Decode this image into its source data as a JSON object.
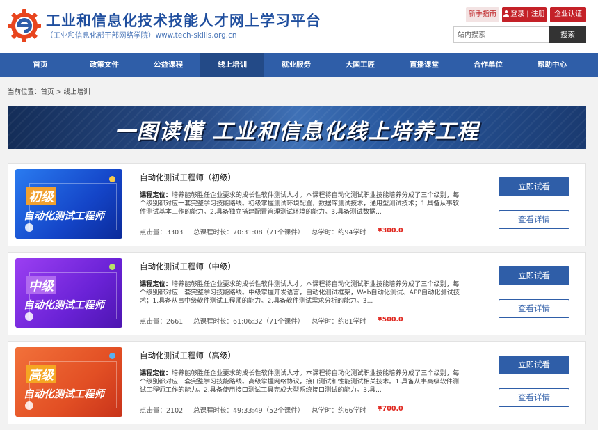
{
  "header": {
    "title": "工业和信息化技术技能人才网上学习平台",
    "subtitle": "（工业和信息化部干部网络学院）www.tech-skills.org.cn",
    "guide_label": "新手指南",
    "login_label": "登录 | 注册",
    "corp_label": "企业认证",
    "search_placeholder": "站内搜索",
    "search_button": "搜索"
  },
  "nav": {
    "items": [
      "首页",
      "政策文件",
      "公益课程",
      "线上培训",
      "就业服务",
      "大国工匠",
      "直播课堂",
      "合作单位",
      "帮助中心"
    ],
    "active": "线上培训"
  },
  "breadcrumb": "当前位置：首页 > 线上培训",
  "banner": {
    "text": "一图读懂 工业和信息化线上培养工程"
  },
  "courses": [
    {
      "thumb_level": "初级",
      "thumb_title": "自动化测试工程师",
      "title": "自动化测试工程师（初级）",
      "desc_label": "课程定位：",
      "desc": "培养能够胜任企业要求的成长性软件测试人才。本课程将自动化测试职业技能培养分成了三个级别，每个级别都对应一套完整学习技能路线。初级掌握测试环境配置，数据库测试技术，通用型测试技术；1.具备从事软件测试基本工作的能力。2.具备独立搭建配置管理测试环境的能力。3.具备测试数据...",
      "views": "点击量：3303",
      "duration": "总课程时长：70:31:08（71个课件）",
      "hours": "总学时：约94学时",
      "price": "¥300.0",
      "try_label": "立即试看",
      "detail_label": "查看详情"
    },
    {
      "thumb_level": "中级",
      "thumb_title": "自动化测试工程师",
      "title": "自动化测试工程师（中级）",
      "desc_label": "课程定位：",
      "desc": "培养能够胜任企业要求的成长性软件测试人才。本课程将自动化测试职业技能培养分成了三个级别，每个级别都对应一套完整学习技能路线。中级掌握开发语言，自动化测试框架，Web自动化测试、APP自动化测试技术；1.具备从事中级软件测试工程师的能力。2.具备软件测试需求分析的能力。3...",
      "views": "点击量：2661",
      "duration": "总课程时长：61:06:32（71个课件）",
      "hours": "总学时：约81学时",
      "price": "¥500.0",
      "try_label": "立即试看",
      "detail_label": "查看详情"
    },
    {
      "thumb_level": "高级",
      "thumb_title": "自动化测试工程师",
      "title": "自动化测试工程师（高级）",
      "desc_label": "课程定位：",
      "desc": "培养能够胜任企业要求的成长性软件测试人才。本课程将自动化测试职业技能培养分成了三个级别，每个级别都对应一套完整学习技能路线。高级掌握网络协议，接口测试和性能测试相关技术。1.具备从事高级软件测试工程师工作的能力。2.具备使用接口测试工具完成大型系统接口测试的能力。3.具...",
      "views": "点击量：2102",
      "duration": "总课程时长：49:33:49（52个课件）",
      "hours": "总学时：约66学时",
      "price": "¥700.0",
      "try_label": "立即试看",
      "detail_label": "查看详情"
    }
  ],
  "colors": {
    "brand_blue": "#2f5ea8",
    "brand_red": "#c42128",
    "price_red": "#e0261e"
  },
  "icons": {
    "logo": "gear-e-logo-icon",
    "login": "user-icon"
  }
}
